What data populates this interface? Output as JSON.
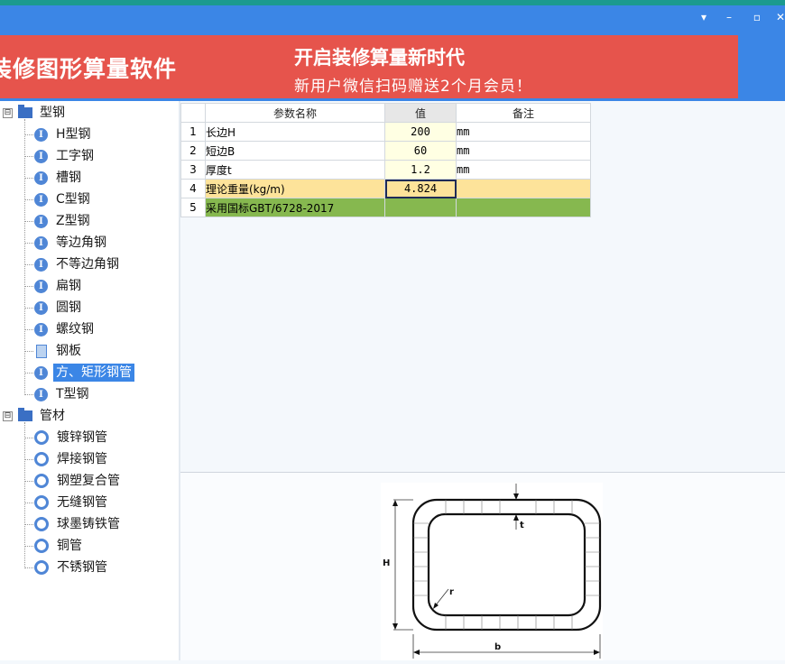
{
  "banner": {
    "product": "装修图形算量软件",
    "headline": "开启装修算量新时代",
    "promo": "新用户微信扫码赠送2个月会员！"
  },
  "window": {
    "minimize": "–",
    "maximize": "▫",
    "close": "✕",
    "menu": "▾"
  },
  "tree": {
    "groups": [
      {
        "label": "型钢",
        "items": [
          "H型钢",
          "工字钢",
          "槽钢",
          "C型钢",
          "Z型钢",
          "等边角钢",
          "不等边角钢",
          "扁钢",
          "圆钢",
          "螺纹钢",
          "钢板",
          "方、矩形钢管",
          "T型钢"
        ]
      },
      {
        "label": "管材",
        "items": [
          "镀锌钢管",
          "焊接钢管",
          "钢塑复合管",
          "无缝钢管",
          "球墨铸铁管",
          "铜管",
          "不锈钢管"
        ]
      }
    ],
    "expander": "⊟",
    "selected": "方、矩形钢管",
    "item_badge": "I"
  },
  "grid": {
    "headers": [
      "参数名称",
      "值",
      "备注"
    ],
    "rows": [
      {
        "n": "1",
        "name": "长边H",
        "value": "200",
        "remark": "mm"
      },
      {
        "n": "2",
        "name": "短边B",
        "value": "60",
        "remark": "mm"
      },
      {
        "n": "3",
        "name": "厚度t",
        "value": "1.2",
        "remark": "mm"
      },
      {
        "n": "4",
        "name": "理论重量(kg/m)",
        "value": "4.824",
        "remark": ""
      },
      {
        "n": "5",
        "name": "采用国标GBT/6728-2017",
        "value": "",
        "remark": ""
      }
    ]
  },
  "diagram": {
    "labels": {
      "height": "H",
      "thickness": "t",
      "radius": "r",
      "width": "b"
    }
  },
  "colors": {
    "accent": "#3b86e6",
    "banner": "#e6544c",
    "highlight_row": "#fde39a",
    "standard_row": "#86b84f"
  }
}
